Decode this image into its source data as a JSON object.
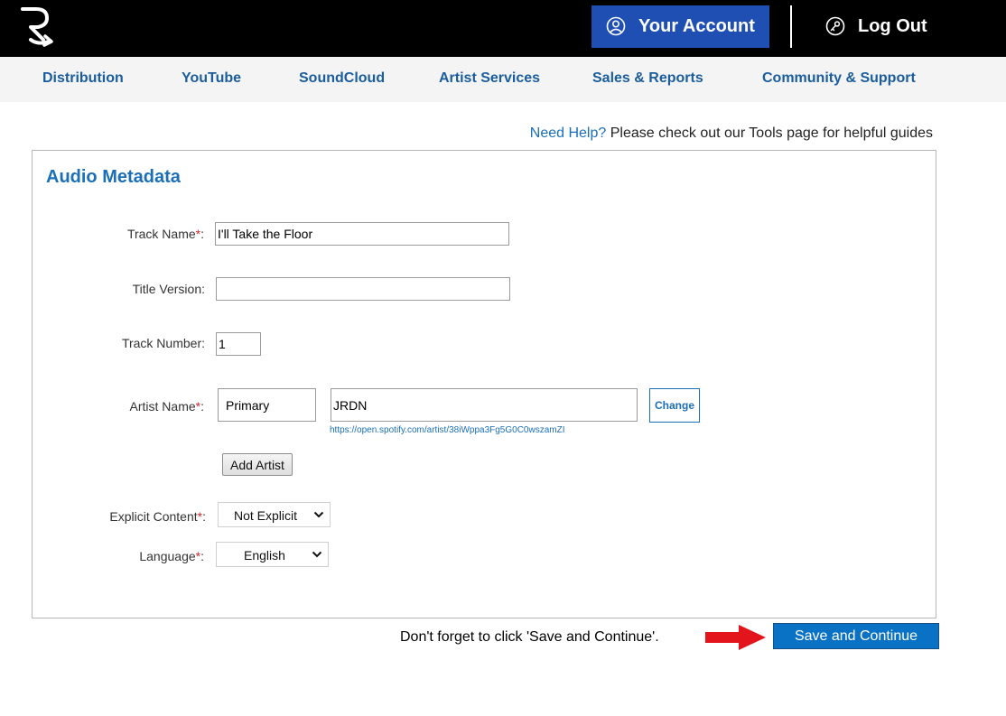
{
  "header": {
    "logo_icon": "r-arrow-logo-icon",
    "account_label": "Your Account",
    "account_icon": "user-circle-icon",
    "logout_label": "Log Out",
    "logout_icon": "key-circle-icon",
    "accent_color": "#1f4fb3"
  },
  "nav": {
    "items": [
      {
        "label": "Distribution"
      },
      {
        "label": "YouTube"
      },
      {
        "label": "SoundCloud"
      },
      {
        "label": "Artist Services"
      },
      {
        "label": "Sales & Reports"
      },
      {
        "label": "Community & Support"
      }
    ]
  },
  "help": {
    "link_text": "Need Help?",
    "message": " Please check out our Tools page for helpful guides"
  },
  "form": {
    "title": "Audio Metadata",
    "required_mark": "*",
    "track_name": {
      "label": "Track Name",
      "value": "I'll Take the Floor"
    },
    "title_version": {
      "label": "Title Version:",
      "value": ""
    },
    "track_number": {
      "label": "Track Number:",
      "value": "1"
    },
    "artist_name": {
      "label": "Artist Name",
      "role": "Primary",
      "value": "JRDN",
      "change_label": "Change",
      "spotify_url": "https://open.spotify.com/artist/38iWppa3Fg5G0C0wszamZI"
    },
    "add_artist_label": "Add Artist",
    "explicit": {
      "label": "Explicit Content",
      "selected": "Not Explicit"
    },
    "language": {
      "label": "Language",
      "selected": "English"
    }
  },
  "footer": {
    "reminder": "Don't forget to click 'Save and Continue'.",
    "arrow_icon": "red-arrow-right-icon",
    "save_label": "Save and Continue",
    "save_color": "#0a72c4"
  }
}
